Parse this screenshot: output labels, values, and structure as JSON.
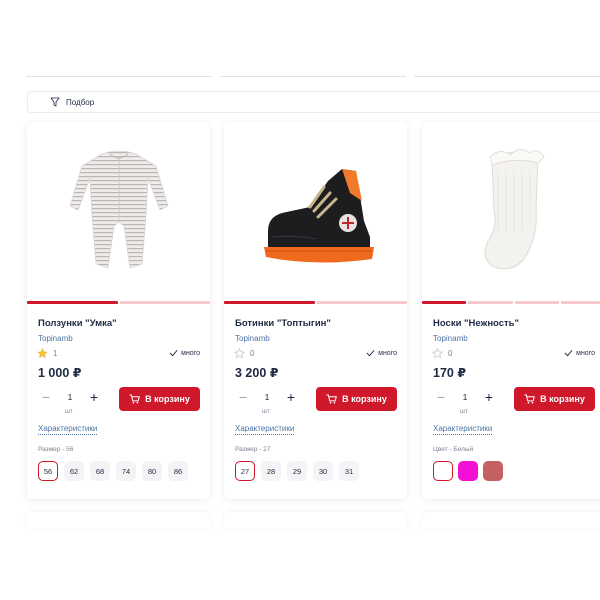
{
  "filter": {
    "label": "Подбор",
    "icon": "filter-icon"
  },
  "products": [
    {
      "name": "Ползунки \"Умка\"",
      "brand": "Topinamb",
      "rating": "1",
      "rating_filled": true,
      "stock": "много",
      "price": "1 000 ₽",
      "qty": "1",
      "unit": "шт",
      "cart_label": "В корзину",
      "chars_label": "Характеристики",
      "option_label": "Размер - 56",
      "sizes": [
        "56",
        "62",
        "68",
        "74",
        "80",
        "86"
      ],
      "selected": "56",
      "image": "striped-bodysuit-image"
    },
    {
      "name": "Ботинки \"Топтыгин\"",
      "brand": "Topinamb",
      "rating": "0",
      "rating_filled": false,
      "stock": "много",
      "price": "3 200 ₽",
      "qty": "1",
      "unit": "шт",
      "cart_label": "В корзину",
      "chars_label": "Характеристики",
      "option_label": "Размер - 27",
      "sizes": [
        "27",
        "28",
        "29",
        "30",
        "31"
      ],
      "selected": "27",
      "image": "black-boot-image"
    },
    {
      "name": "Носки \"Нежность\"",
      "brand": "Topinamb",
      "rating": "0",
      "rating_filled": false,
      "stock": "много",
      "price": "170 ₽",
      "qty": "1",
      "unit": "шт",
      "cart_label": "В корзину",
      "chars_label": "Характеристики",
      "option_label": "Цвет - Белый",
      "colors": [
        "#ffffff",
        "#f20fd6",
        "#c46062"
      ],
      "selected_color": "#ffffff",
      "image": "white-sock-image"
    }
  ],
  "colors": {
    "accent": "#d0182b",
    "accent_light": "#f7c8cc",
    "text": "#1f2a44",
    "link": "#4b74a5",
    "muted": "#7a8190"
  }
}
